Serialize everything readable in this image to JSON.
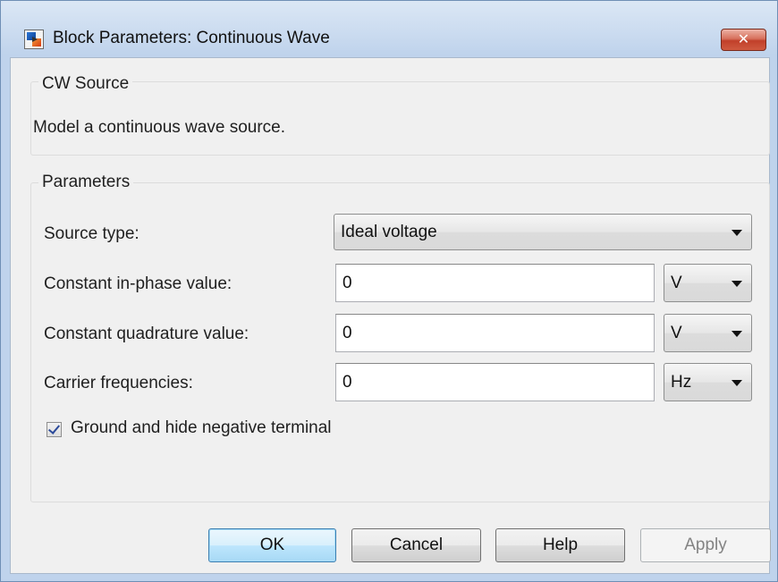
{
  "window": {
    "title": "Block Parameters: Continuous Wave",
    "close_label": "✕"
  },
  "source_group": {
    "legend": "CW Source",
    "description": "Model a continuous wave source."
  },
  "parameters_group": {
    "legend": "Parameters",
    "source_type": {
      "label": "Source type:",
      "value": "Ideal voltage"
    },
    "in_phase": {
      "label": "Constant in-phase value:",
      "value": "0",
      "unit": "V"
    },
    "quadrature": {
      "label": "Constant quadrature value:",
      "value": "0",
      "unit": "V"
    },
    "carrier": {
      "label": "Carrier frequencies:",
      "value": "0",
      "unit": "Hz"
    },
    "ground_checkbox": {
      "label": "Ground and hide negative terminal",
      "checked": true
    }
  },
  "buttons": {
    "ok": "OK",
    "cancel": "Cancel",
    "help": "Help",
    "apply": "Apply"
  },
  "colors": {
    "title_gradient_top": "#dbe7f5",
    "close_button": "#c1402a",
    "default_button_border": "#3c7fb1",
    "dialog_background": "#f0f0f0"
  }
}
